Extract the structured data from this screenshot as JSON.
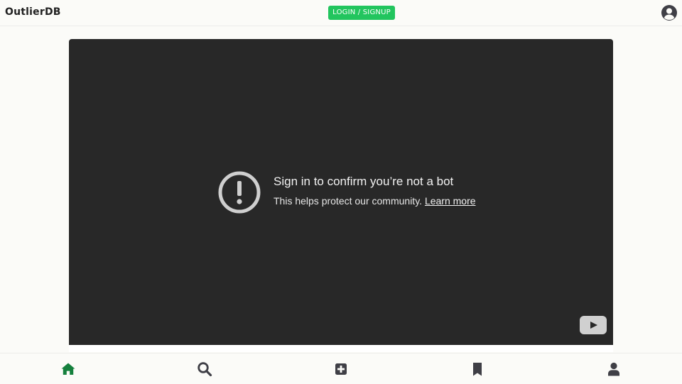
{
  "header": {
    "brand": "OutlierDB",
    "login_label": "LOGIN / SIGNUP",
    "account_icon": "account-circle-icon"
  },
  "player": {
    "title": "Sign in to confirm you’re not a bot",
    "subtitle": "This helps protect our community.",
    "link_label": "Learn more",
    "warning_icon": "exclamation-circle-icon",
    "play_icon": "youtube-play-icon"
  },
  "bottom_nav": {
    "items": [
      {
        "name": "home",
        "icon": "home-icon",
        "active": true
      },
      {
        "name": "search",
        "icon": "search-icon",
        "active": false
      },
      {
        "name": "add",
        "icon": "plus-square-icon",
        "active": false
      },
      {
        "name": "bookmarks",
        "icon": "bookmark-icon",
        "active": false
      },
      {
        "name": "profile",
        "icon": "user-icon",
        "active": false
      }
    ]
  },
  "colors": {
    "accent_green": "#22c55e",
    "active_nav": "#15803d",
    "inactive_nav": "#3f3f46",
    "player_bg": "#282828",
    "page_bg": "#fbfbf8"
  }
}
